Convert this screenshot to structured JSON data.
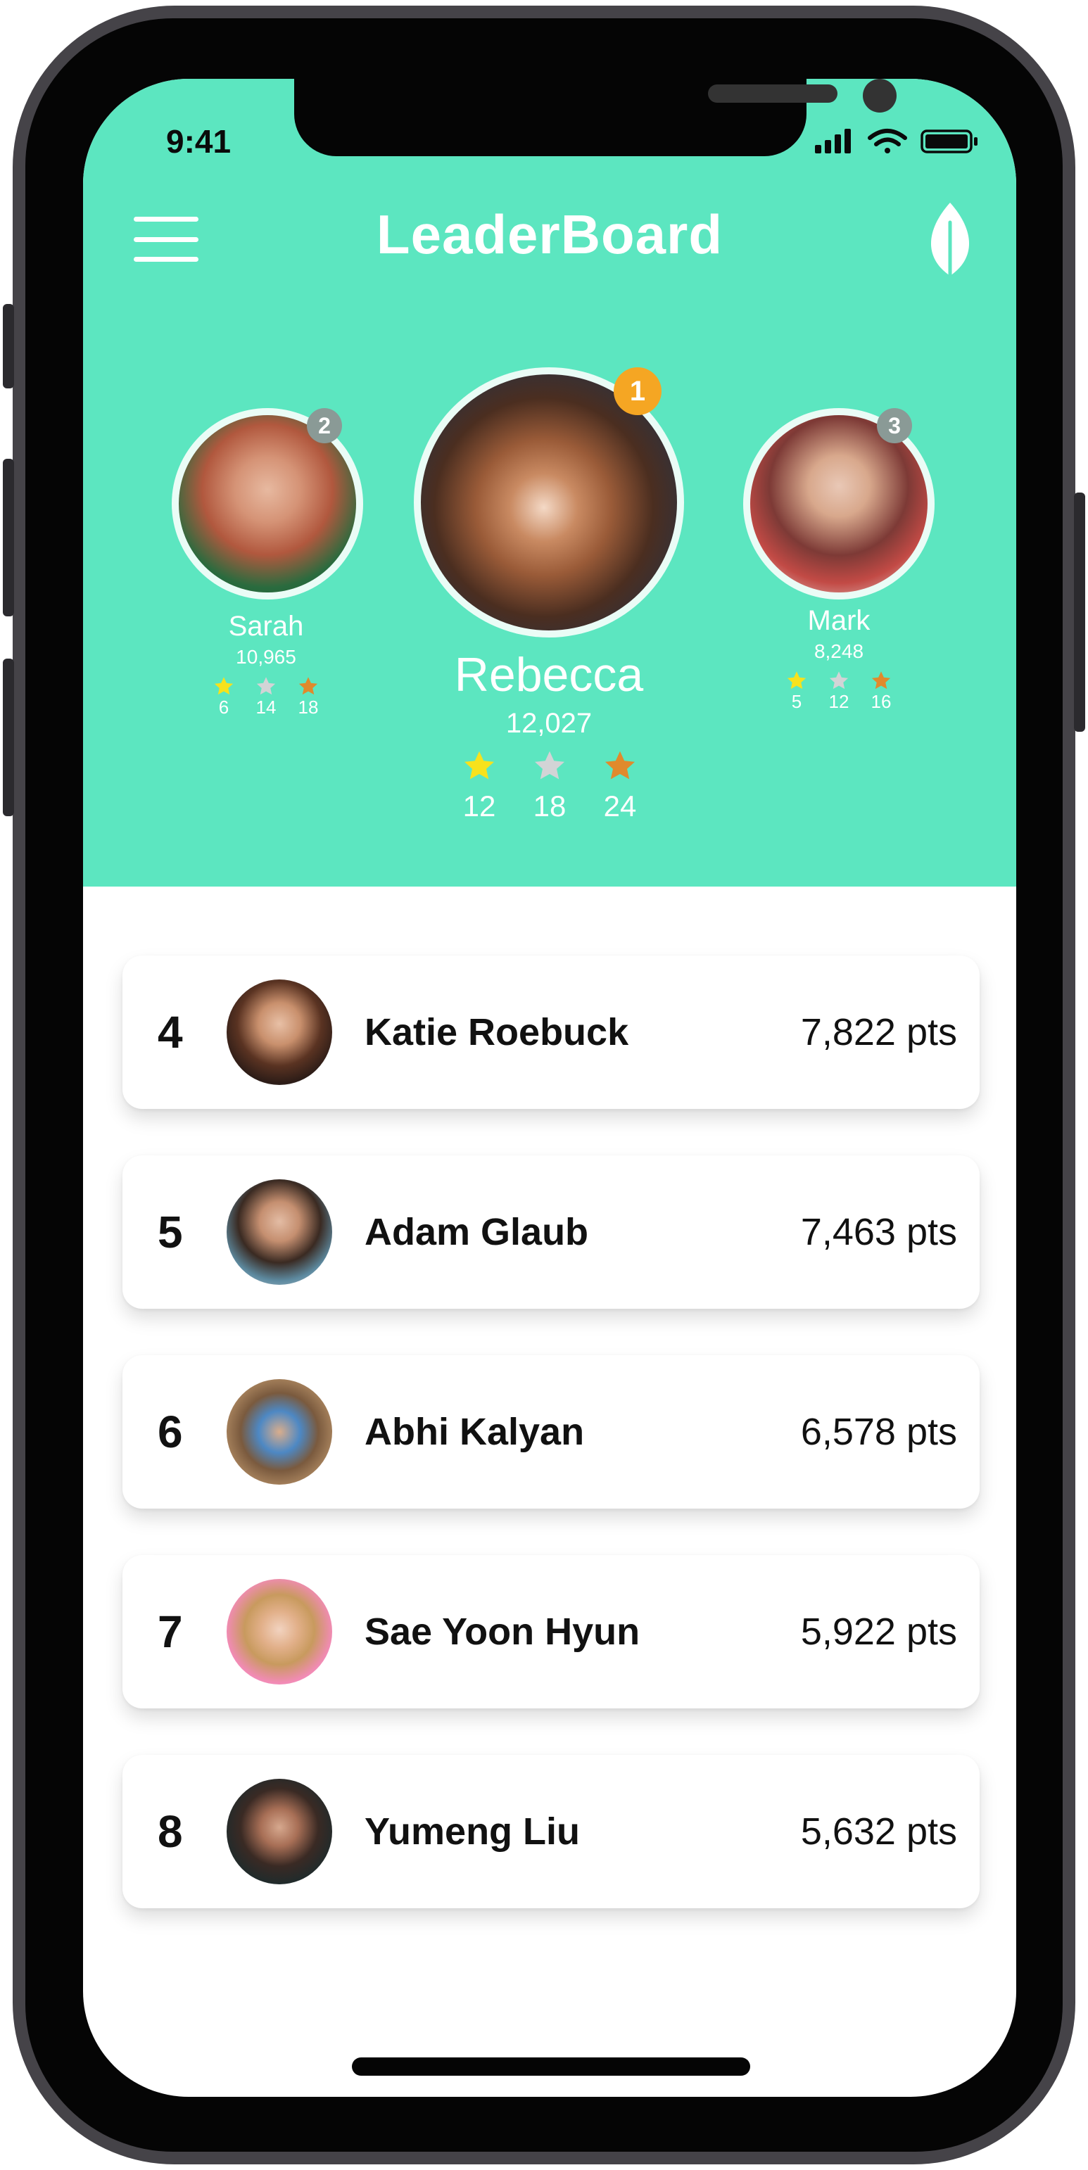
{
  "status_bar": {
    "time": "9:41"
  },
  "header": {
    "title": "LeaderBoard",
    "bg_color": "#5ce6c0"
  },
  "podium": [
    {
      "rank": "1",
      "name": "Rebecca",
      "score": "12,027",
      "gold": "12",
      "silver": "18",
      "bronze": "24",
      "badge_color": "#f5a623"
    },
    {
      "rank": "2",
      "name": "Sarah",
      "score": "10,965",
      "gold": "6",
      "silver": "14",
      "bronze": "18",
      "badge_color": "#8a9a96"
    },
    {
      "rank": "3",
      "name": "Mark",
      "score": "8,248",
      "gold": "5",
      "silver": "12",
      "bronze": "16",
      "badge_color": "#8a9a96"
    }
  ],
  "medal_colors": {
    "gold": "#f7e21c",
    "silver": "#d2d4d6",
    "bronze": "#e08a2c"
  },
  "rankings": [
    {
      "rank": "4",
      "name": "Katie Roebuck",
      "points": "7,822 pts"
    },
    {
      "rank": "5",
      "name": "Adam Glaub",
      "points": "7,463 pts"
    },
    {
      "rank": "6",
      "name": "Abhi Kalyan",
      "points": "6,578 pts"
    },
    {
      "rank": "7",
      "name": "Sae Yoon Hyun",
      "points": "5,922 pts"
    },
    {
      "rank": "8",
      "name": "Yumeng Liu",
      "points": "5,632 pts"
    }
  ],
  "icons": [
    "menu-icon",
    "leaf-icon",
    "signal-icon",
    "wifi-icon",
    "battery-icon",
    "star-icon"
  ]
}
